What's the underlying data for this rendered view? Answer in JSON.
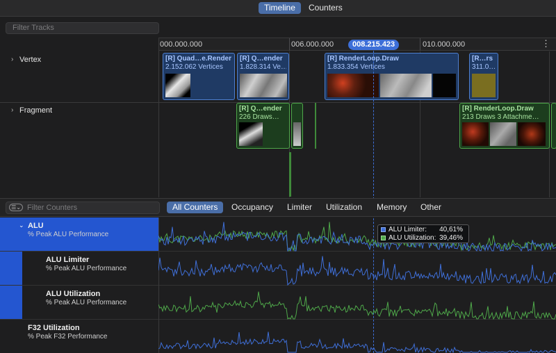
{
  "top_tabs": [
    {
      "label": "Timeline",
      "active": true
    },
    {
      "label": "Counters",
      "active": false
    }
  ],
  "filter_tracks_placeholder": "Filter Tracks",
  "ruler": {
    "labels": [
      "000.000.000",
      "006.000.000",
      "010.000.000"
    ],
    "playhead": "008.215.423",
    "more": "⋮"
  },
  "tracks": [
    {
      "label": "Vertex"
    },
    {
      "label": "Fragment"
    }
  ],
  "vertex_encoders": [
    {
      "title": "[R] Quad…e.Render",
      "sub": "2.152.062 Vertices"
    },
    {
      "title": "[R] Q…ender",
      "sub": "1.828.314 Ve…"
    },
    {
      "title": "[R] RenderLoop.Draw",
      "sub": "1.833.354 Vertices"
    },
    {
      "title": "[R…rs",
      "sub": "311.0…"
    }
  ],
  "fragment_encoders": [
    {
      "title": "[R] Q…ender",
      "sub": "226 Draws…"
    },
    {
      "title": "[R] RenderLoop.Draw",
      "sub": "213 Draws    3 Attachme…"
    }
  ],
  "filter_counters_placeholder": "Filter Counters",
  "counter_tabs": [
    {
      "label": "All Counters",
      "active": true
    },
    {
      "label": "Occupancy",
      "active": false
    },
    {
      "label": "Limiter",
      "active": false
    },
    {
      "label": "Utilization",
      "active": false
    },
    {
      "label": "Memory",
      "active": false
    },
    {
      "label": "Other",
      "active": false
    }
  ],
  "counters": [
    {
      "name": "ALU",
      "sub": "% Peak ALU Performance"
    },
    {
      "name": "ALU Limiter",
      "sub": "% Peak ALU Performance"
    },
    {
      "name": "ALU Utilization",
      "sub": "% Peak ALU Performance"
    },
    {
      "name": "F32 Utilization",
      "sub": "% Peak F32 Performance"
    }
  ],
  "legend": [
    {
      "name": "ALU Limiter:",
      "value": "40,61%",
      "color": "#3f6fd8"
    },
    {
      "name": "ALU Utilization:",
      "value": "39,46%",
      "color": "#4fa84a"
    }
  ],
  "colors": {
    "accent": "#2456d0",
    "blue_series": "#3f6fd8",
    "green_series": "#4fa84a"
  }
}
